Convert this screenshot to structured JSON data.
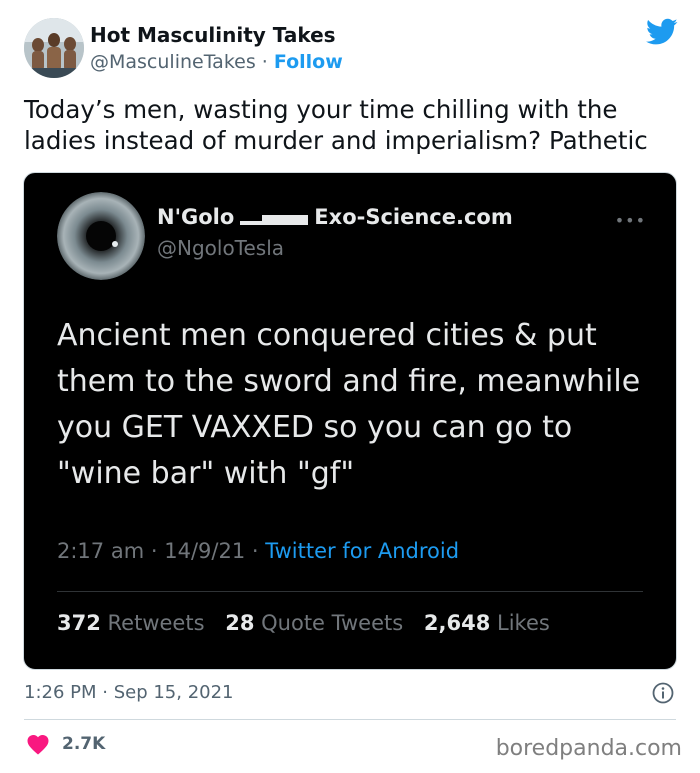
{
  "author": {
    "name": "Hot Masculinity Takes",
    "handle": "@MasculineTakes",
    "separator": "·",
    "follow_label": "Follow"
  },
  "tweet_text": "Today’s men, wasting your time chilling with the\nladies instead of murder and imperialism? Pathetic",
  "embedded": {
    "name": "N'Golo",
    "name_suffix": "Exo-Science.com",
    "handle": "@NgoloTesla",
    "more_label": "•••",
    "text": "Ancient men conquered cities & put\nthem to the sword and fire, meanwhile\nyou GET VAXXED so you can go to\n\"wine bar\" with \"gf\"",
    "time": "2:17 am",
    "date": "14/9/21",
    "separator": "·",
    "source_app": "Twitter for Android",
    "stats": {
      "retweets_count": "372",
      "retweets_label": "Retweets",
      "quotes_count": "28",
      "quotes_label": "Quote Tweets",
      "likes_count": "2,648",
      "likes_label": "Likes"
    }
  },
  "timestamp": "1:26 PM · Sep 15, 2021",
  "likes": "2.7K",
  "watermark": "boredpanda.com",
  "colors": {
    "twitter_blue": "#1d9bf0",
    "heart_red": "#f91880",
    "media_bg": "#000000"
  },
  "icons": {
    "brand": "twitter-bird-icon",
    "info": "info-circle-icon",
    "like": "heart-icon",
    "more": "more-dots-icon"
  }
}
